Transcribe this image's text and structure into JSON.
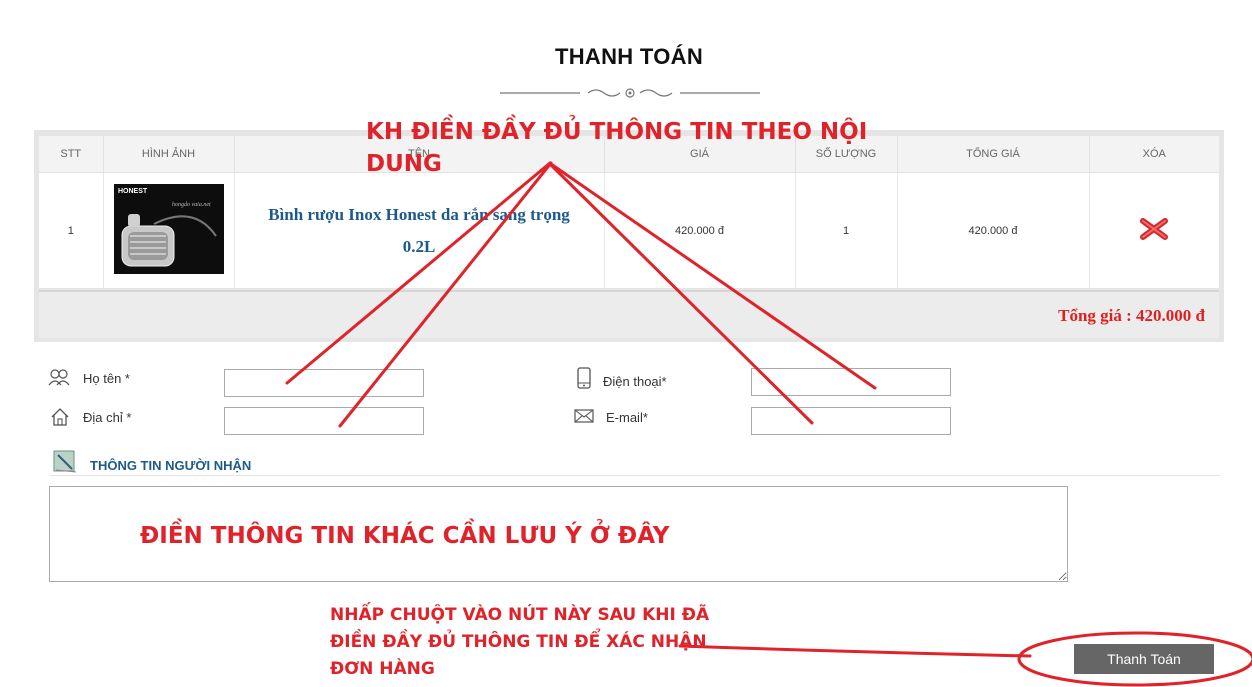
{
  "page": {
    "title": "THANH TOÁN"
  },
  "cart": {
    "columns": [
      "STT",
      "HÌNH ẢNH",
      "TÊN",
      "GIÁ",
      "SỐ LƯỢNG",
      "TỔNG GIÁ",
      "XÓA"
    ],
    "rows": [
      {
        "stt": "1",
        "image_alt": "Bình rượu Inox Honest",
        "image_brand": "HONEST",
        "image_caption": "hongdo vaia.net",
        "name": "Bình rượu Inox Honest da rắn sang trọng 0.2L",
        "price": "420.000 đ",
        "quantity": "1",
        "total": "420.000 đ",
        "delete_icon": "red-x-icon"
      }
    ],
    "grand_total": "Tổng giá : 420.000 đ"
  },
  "form": {
    "name_label": "Họ tên *",
    "address_label": "Địa chỉ *",
    "phone_label": "Điện thoại*",
    "email_label": "E-mail*",
    "name_value": "",
    "address_value": "",
    "phone_value": "",
    "email_value": "",
    "icons": {
      "name": "users-icon",
      "address": "home-icon",
      "phone": "mobile-icon",
      "email": "envelope-icon",
      "receiver": "note-icon"
    },
    "receiver_title": "THÔNG TIN NGƯỜI NHẬN",
    "note_value": "",
    "submit_label": "Thanh Toán"
  },
  "annotations": {
    "fill_info_line1": "KH ĐIỀN ĐẦY ĐỦ THÔNG TIN THEO NỘI",
    "fill_info_line2": "DUNG",
    "note_hint": "ĐIỀN THÔNG TIN KHÁC CẦN LƯU Ý Ở ĐÂY",
    "click_hint_line1": "NHẤP CHUỘT VÀO NÚT NÀY SAU KHI ĐÃ",
    "click_hint_line2": "ĐIỀN ĐẦY ĐỦ THÔNG TIN ĐỂ XÁC NHẬN",
    "click_hint_line3": "ĐƠN HÀNG",
    "color": "#e0232a"
  },
  "colors": {
    "accent_blue": "#1d5a8c",
    "total_red": "#e21f1f",
    "button_gray": "#666666"
  }
}
